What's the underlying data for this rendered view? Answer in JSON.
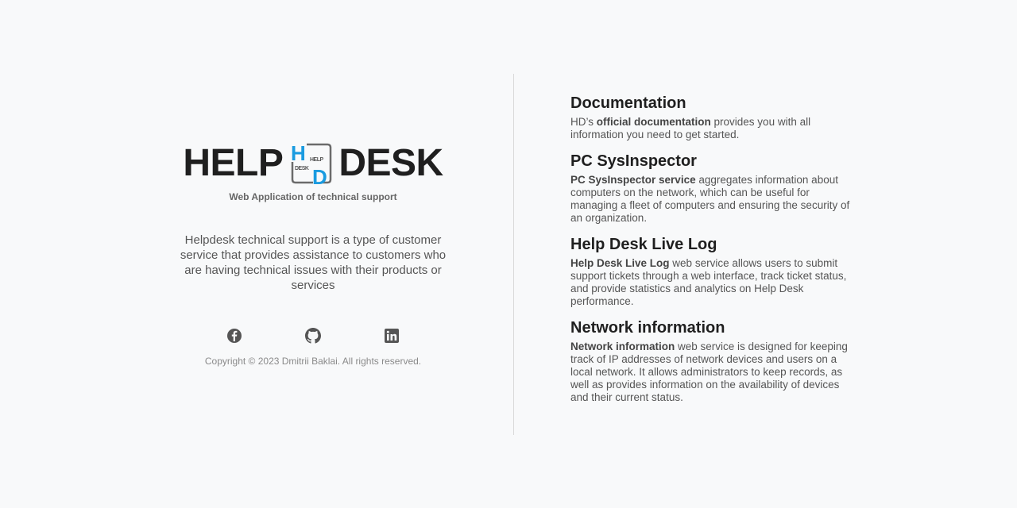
{
  "brand": {
    "word_left": "HELP",
    "word_right": "DESK",
    "mark_small_top": "HELP",
    "mark_small_bottom": "DESK",
    "mark_letter_h": "H",
    "mark_letter_d": "D",
    "tagline": "Web Application of technical support",
    "accent_color": "#1a9be0"
  },
  "intro": "Helpdesk technical support is a type of customer service that provides assistance to customers who are having technical issues with their products or services",
  "social": [
    {
      "name": "facebook-icon"
    },
    {
      "name": "github-icon"
    },
    {
      "name": "linkedin-icon"
    }
  ],
  "copyright": "Copyright © 2023 Dmitrii Baklai. All rights reserved.",
  "sections": [
    {
      "title": "Documentation",
      "lead": "HD’s ",
      "bold": "official documentation",
      "rest": " provides you with all information you need to get started."
    },
    {
      "title": "PC SysInspector",
      "lead": "",
      "bold": "PC SysInspector service",
      "rest": " aggregates information about computers on the network, which can be useful for managing a fleet of computers and ensuring the security of an organization."
    },
    {
      "title": "Help Desk Live Log",
      "lead": "",
      "bold": "Help Desk Live Log",
      "rest": " web service allows users to submit support tickets through a web interface, track ticket status, and provide statistics and analytics on Help Desk performance."
    },
    {
      "title": "Network information",
      "lead": "",
      "bold": "Network information",
      "rest": " web service is designed for keeping track of IP addresses of network devices and users on a local network. It allows administrators to keep records, as well as provides information on the availability of devices and their current status."
    }
  ]
}
